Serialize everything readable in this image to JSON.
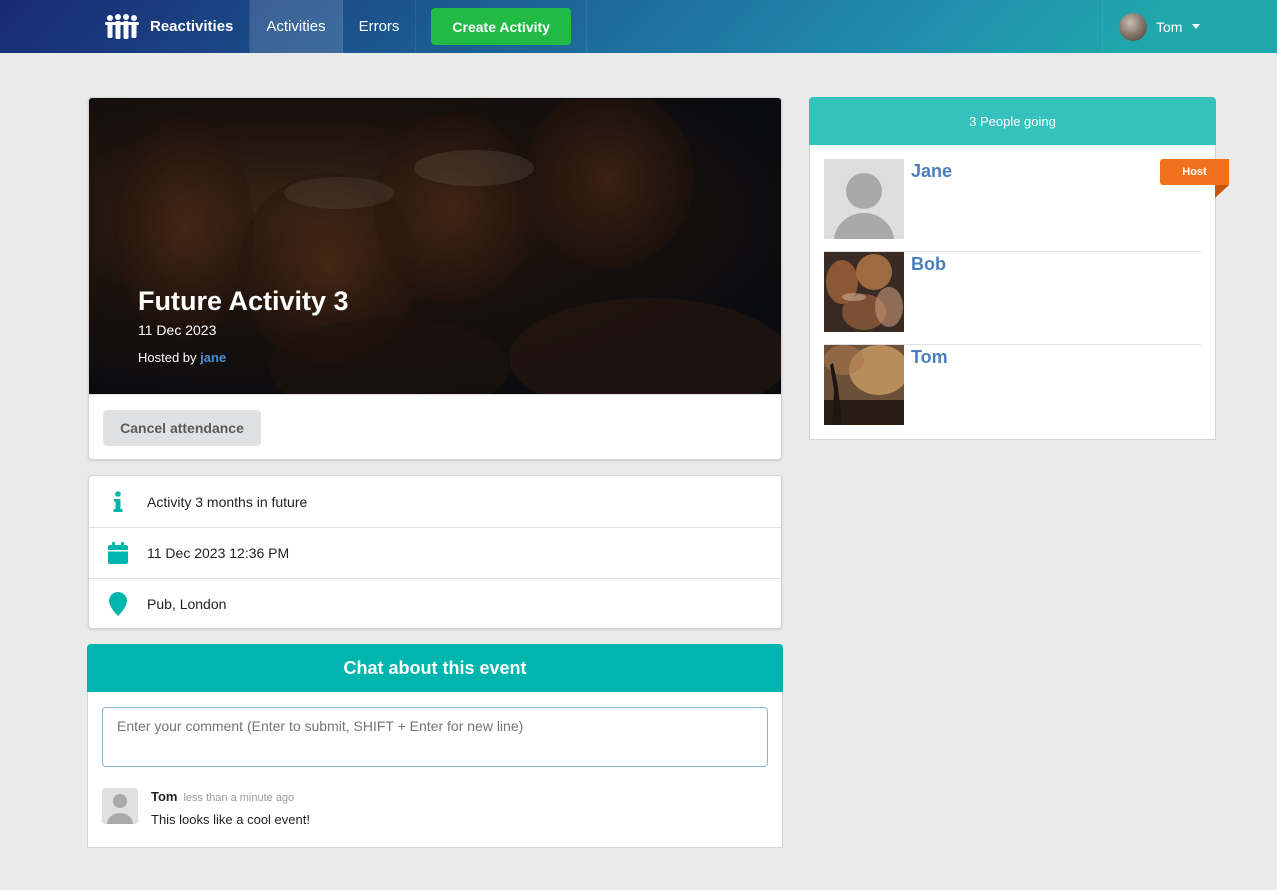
{
  "navbar": {
    "brand": "Reactivities",
    "items": [
      {
        "label": "Activities",
        "active": true
      },
      {
        "label": "Errors",
        "active": false
      }
    ],
    "create_button": "Create Activity",
    "user_name": "Tom"
  },
  "activity": {
    "title": "Future Activity 3",
    "date": "11 Dec 2023",
    "hosted_by_prefix": "Hosted by ",
    "host": "jane",
    "cancel_button": "Cancel attendance",
    "description": "Activity 3 months in future",
    "datetime": "11 Dec 2023 12:36 PM",
    "location": "Pub, London"
  },
  "chat": {
    "title": "Chat about this event",
    "placeholder": "Enter your comment (Enter to submit, SHIFT + Enter for new line)",
    "comments": [
      {
        "author": "Tom",
        "time": "less than a minute ago",
        "text": "This looks like a cool event!"
      }
    ]
  },
  "sidebar": {
    "header": "3 People going",
    "host_label": "Host",
    "attendees": [
      {
        "name": "Jane",
        "image": "default-user-avatar",
        "is_host": true
      },
      {
        "name": "Bob",
        "image": "drinks-photo",
        "is_host": false
      },
      {
        "name": "Tom",
        "image": "concert-photo",
        "is_host": false
      }
    ]
  },
  "colors": {
    "teal": "#00b5ad",
    "green": "#21ba45",
    "orange": "#f2711c",
    "link_blue": "#4b7fbb"
  }
}
